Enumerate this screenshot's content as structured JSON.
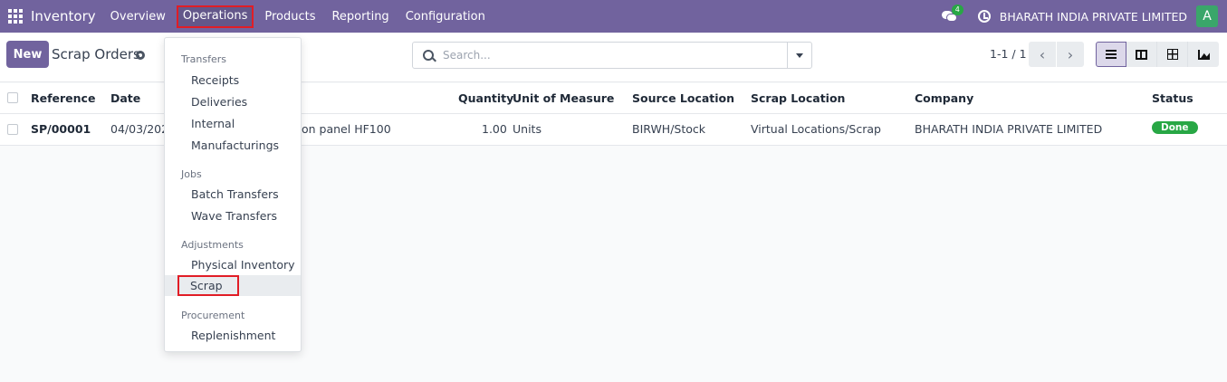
{
  "navbar": {
    "app_name": "Inventory",
    "menu": [
      "Overview",
      "Operations",
      "Products",
      "Reporting",
      "Configuration"
    ],
    "chat_badge": "4",
    "company": "BHARATH INDIA PRIVATE LIMITED",
    "avatar_letter": "A",
    "bg_color": "#71639e"
  },
  "control": {
    "new_label": "New",
    "title": "Scrap Orders",
    "search_placeholder": "Search...",
    "pager": "1-1 / 1"
  },
  "table": {
    "headers": [
      "Reference",
      "Date",
      "Quantity",
      "Unit of Measure",
      "Source Location",
      "Scrap Location",
      "Company",
      "Status"
    ],
    "rows": [
      {
        "reference": "SP/00001",
        "date": "04/03/202",
        "product": "on panel HF100",
        "quantity": "1.00",
        "uom": "Units",
        "source": "BIRWH/Stock",
        "scrap_location": "Virtual Locations/Scrap",
        "company": "BHARATH INDIA PRIVATE LIMITED",
        "status": "Done"
      }
    ]
  },
  "dropdown": {
    "sections": [
      "Transfers",
      "Jobs",
      "Adjustments",
      "Procurement"
    ],
    "transfers": [
      "Receipts",
      "Deliveries",
      "Internal",
      "Manufacturings"
    ],
    "jobs": [
      "Batch Transfers",
      "Wave Transfers"
    ],
    "adjustments": [
      "Physical Inventory",
      "Scrap"
    ],
    "procurement": [
      "Replenishment"
    ]
  }
}
